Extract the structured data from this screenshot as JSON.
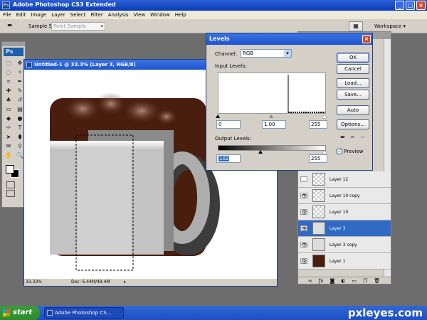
{
  "app": {
    "title": "Adobe Photoshop CS3 Extended"
  },
  "menu": [
    "File",
    "Edit",
    "Image",
    "Layer",
    "Select",
    "Filter",
    "Analysis",
    "View",
    "Window",
    "Help"
  ],
  "options_bar": {
    "sample_size_label": "Sample Size:",
    "sample_size_value": "Point Sample",
    "workspace_label": "Workspace"
  },
  "tools": {
    "logo": "Ps"
  },
  "document": {
    "title": "Untitled-1 @ 33.3% (Layer 3, RGB/8)",
    "zoom": "33.33%",
    "doc_info": "Doc: 6.44M/49.4M"
  },
  "levels": {
    "title": "Levels",
    "channel_label": "Channel:",
    "channel_value": "RGB",
    "input_label": "Input Levels:",
    "input_values": [
      "0",
      "1.00",
      "255"
    ],
    "output_label": "Output Levels:",
    "output_values": [
      "102",
      "255"
    ],
    "buttons": {
      "ok": "OK",
      "cancel": "Cancel",
      "load": "Load...",
      "save": "Save...",
      "auto": "Auto",
      "options": "Options..."
    },
    "preview_label": "Preview",
    "preview_checked": true
  },
  "layers": [
    {
      "name": "Layer 12",
      "thumb": "transparent",
      "selected": false,
      "visible": false
    },
    {
      "name": "Layer 10 copy",
      "thumb": "transparent",
      "selected": false,
      "visible": true
    },
    {
      "name": "Layer 10",
      "thumb": "transparent",
      "selected": false,
      "visible": true
    },
    {
      "name": "Layer 3",
      "thumb": "mug",
      "selected": true,
      "visible": true
    },
    {
      "name": "Layer 3 copy",
      "thumb": "mug",
      "selected": false,
      "visible": true
    },
    {
      "name": "Layer 1",
      "thumb": "brown",
      "selected": false,
      "visible": true
    }
  ],
  "taskbar": {
    "start_label": "start",
    "task_label": "Adobe Photoshop CS...",
    "watermark": "pxleyes.com"
  },
  "colors": {
    "accent_blue": "#316ac5",
    "coffee_brown": "#4a1e0f",
    "mug_gray": "#c4c4c4",
    "taskbar_blue": "#1c4fc4",
    "start_green": "#2d8a2d"
  }
}
